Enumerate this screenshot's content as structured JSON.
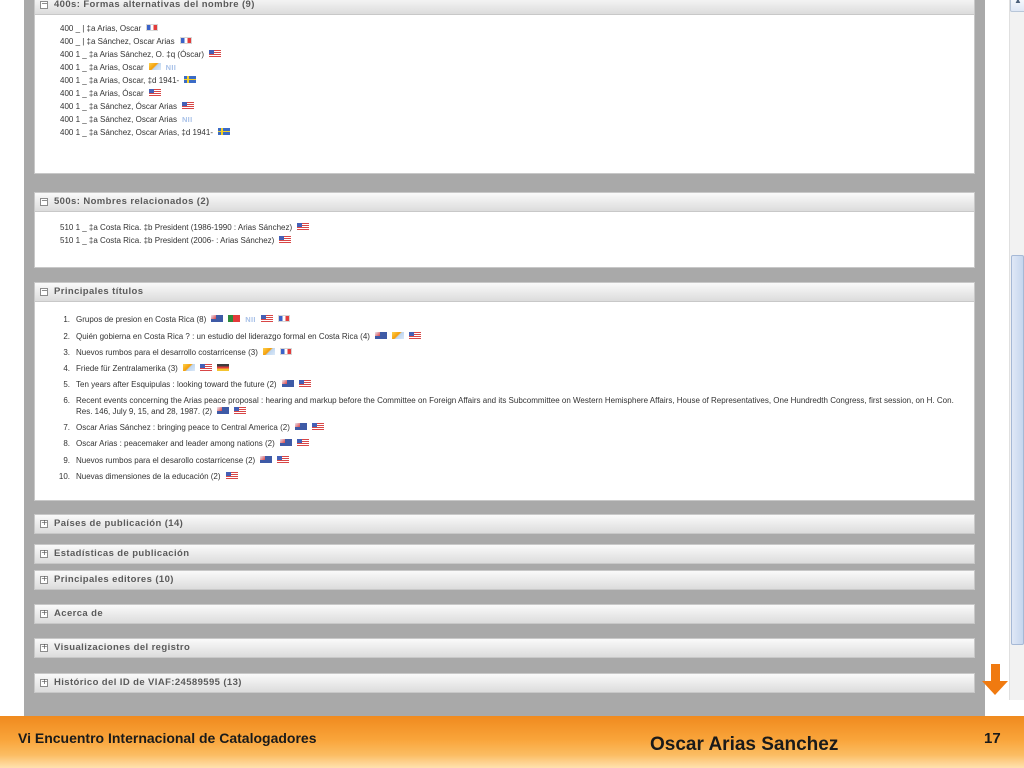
{
  "panels": {
    "alt_names": {
      "title": "400s: Formas alternativas del nombre (9)",
      "lines": [
        "400 _ | ‡a  Arias, Oscar",
        "400 _ | ‡a  Sánchez, Oscar Arias",
        "400 1 _ ‡a  Arias Sánchez, O. ‡q  (Óscar)",
        "400 1 _ ‡a  Arias, Oscar",
        "400 1 _ ‡a  Arias, Oscar, ‡d  1941-",
        "400 1 _ ‡a  Arias, Óscar",
        "400 1 _ ‡a  Sánchez, Óscar Arias",
        "400 1 _ ‡a  Sánchez, Oscar Arias",
        "400 1 _ ‡a  Sánchez, Oscar Arias, ‡d  1941-"
      ]
    },
    "related_names": {
      "title": "500s: Nombres relacionados (2)",
      "lines": [
        "510 1 _ ‡a  Costa Rica. ‡b  President (1986-1990 : Arias Sánchez)",
        "510 1 _ ‡a  Costa Rica. ‡b  President (2006- : Arias Sánchez)"
      ]
    },
    "main_titles": {
      "title": "Principales títulos",
      "items": [
        {
          "num": "1.",
          "text": "Grupos de presion en Costa Rica (8)"
        },
        {
          "num": "2.",
          "text": "Quién gobierna en Costa Rica ? : un estudio del liderazgo formal en Costa Rica (4)"
        },
        {
          "num": "3.",
          "text": "Nuevos rumbos para el desarrollo costarricense (3)"
        },
        {
          "num": "4.",
          "text": "Friede für Zentralamerika (3)"
        },
        {
          "num": "5.",
          "text": "Ten years after Esquipulas : looking toward the future (2)"
        },
        {
          "num": "6.",
          "text": "Recent events concerning the Arias peace proposal : hearing and markup before the Committee on Foreign Affairs and its Subcommittee on Western Hemisphere Affairs, House of Representatives, One Hundredth Congress, first session, on H. Con. Res. 146, July 9, 15, and 28, 1987. (2)"
        },
        {
          "num": "7.",
          "text": "Oscar Arias Sánchez : bringing peace to Central America (2)"
        },
        {
          "num": "8.",
          "text": "Oscar Arias : peacemaker and leader among nations (2)"
        },
        {
          "num": "9.",
          "text": "Nuevos rumbos para el desarollo costarricense (2)"
        },
        {
          "num": "10.",
          "text": "Nuevas dimensiones de la educación (2)"
        }
      ]
    },
    "countries": {
      "title": "Países de publicación (14)"
    },
    "stats": {
      "title": "Estadísticas de publicación"
    },
    "publishers": {
      "title": "Principales editores (10)"
    },
    "about": {
      "title": "Acerca de"
    },
    "record_views": {
      "title": "Visualizaciones del registro"
    },
    "history": {
      "title": "Histórico del ID de VIAF:24589595 (13)"
    }
  },
  "source_label": "NII",
  "toggle": {
    "expanded": "−",
    "collapsed": "+"
  },
  "scroll_up_glyph": "▲",
  "footer": {
    "left": "Vi Encuentro Internacional de Catalogadores",
    "center": "Oscar Arias Sanchez",
    "page": "17"
  },
  "colors": {
    "footer_orange": "#f08a1e",
    "arrow": "#f07a10",
    "panel_header_text": "#5a5a5a",
    "content_background": "#a9a9a9",
    "source_label": "#a8c1e8"
  },
  "icons": {
    "fr": "flag-france-icon",
    "us": "flag-usa-icon",
    "se": "flag-sweden-icon",
    "il": "flag-israel-icon",
    "au": "flag-australia-icon",
    "pt": "flag-portugal-icon",
    "de": "flag-germany-icon",
    "arrow": "arrow-down-icon"
  }
}
